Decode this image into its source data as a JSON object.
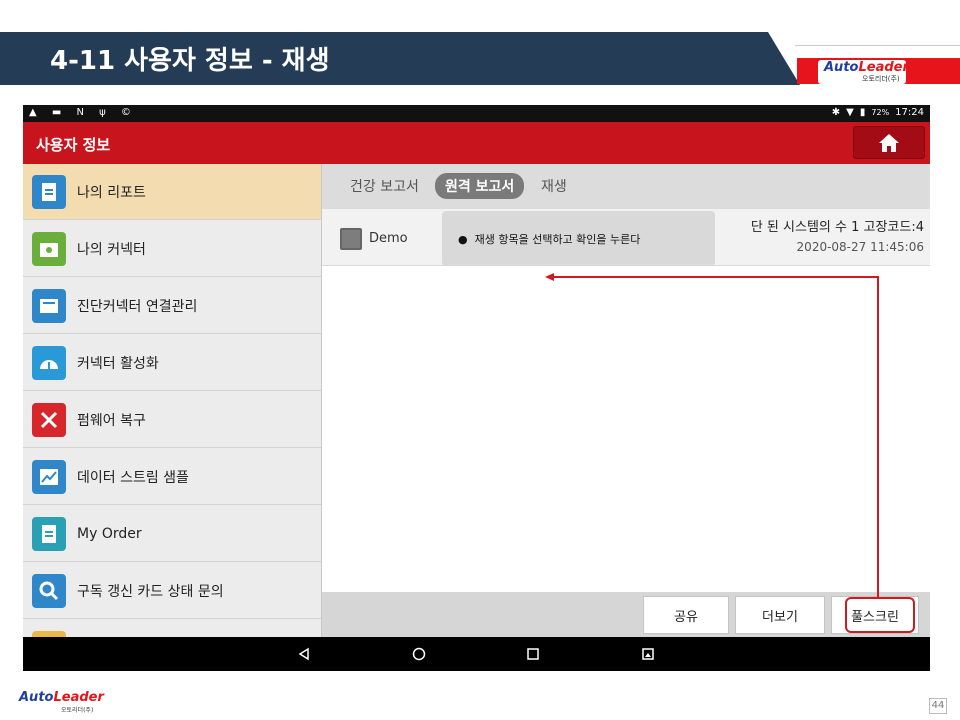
{
  "slide": {
    "title": "4-11 사용자 정보 - 재생",
    "page_number": "44",
    "logo_part1": "Auto",
    "logo_part2": "Leader",
    "logo_sub": "오토리더(주)"
  },
  "statusbar": {
    "left_icons": "▲ ▬ N ψ ©",
    "battery": "72%",
    "time": "17:24"
  },
  "appbar": {
    "title": "사용자 정보",
    "home_icon": "home-icon"
  },
  "sidebar": {
    "items": [
      {
        "label": "나의 리포트",
        "icon": "report-icon",
        "color": "#2f86c9",
        "active": true
      },
      {
        "label": "나의 커넥터",
        "icon": "connector-icon",
        "color": "#6aae3c"
      },
      {
        "label": "진단커넥터 연결관리",
        "icon": "card-icon",
        "color": "#2f86c9"
      },
      {
        "label": "커넥터 활성화",
        "icon": "gauge-icon",
        "color": "#2a9ad6"
      },
      {
        "label": "펌웨어 복구",
        "icon": "tools-icon",
        "color": "#d7262c"
      },
      {
        "label": "데이터 스트림 샘플",
        "icon": "chart-icon",
        "color": "#2f86c9"
      },
      {
        "label": "My Order",
        "icon": "order-icon",
        "color": "#2aa0b5"
      },
      {
        "label": "구독 갱신 카드 상태 문의",
        "icon": "search-icon",
        "color": "#2f86c9"
      },
      {
        "label": "",
        "icon": "folder-icon",
        "color": "#e8b84a"
      }
    ]
  },
  "tabs": [
    {
      "label": "건강 보고서"
    },
    {
      "label": "원격 보고서",
      "active": true
    },
    {
      "label": "재생"
    }
  ],
  "list": {
    "rows": [
      {
        "name": "Demo",
        "title": "단 된 시스템의 수 1 고장코드:4",
        "time": "2020-08-27 11:45:06"
      }
    ]
  },
  "callout": {
    "text": "재생 항목을 선택하고 확인을 누른다"
  },
  "bottom_buttons": {
    "share": "공유",
    "more": "더보기",
    "fullscreen": "풀스크린"
  },
  "colors": {
    "accent_red": "#c8141d",
    "header_navy": "#243c56",
    "highlight": "#d01a22"
  }
}
